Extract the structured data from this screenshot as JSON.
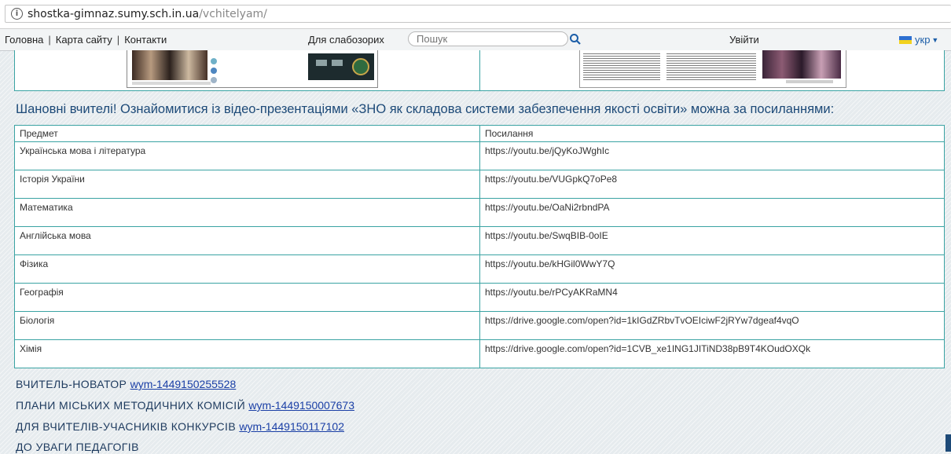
{
  "browser": {
    "url_host": "shostka-gimnaz.sumy.sch.in.ua",
    "url_path": "/vchitelyam/"
  },
  "nav": {
    "home": "Головна",
    "sitemap": "Карта сайту",
    "contacts": "Контакти",
    "visually_impaired": "Для слабозорих",
    "search_placeholder": "Пошук",
    "login": "Увійти",
    "language": "укр"
  },
  "headline": "Шановні вчителі! Ознайомитися із відео-презентаціями «ЗНО як складова системи забезпечення якості освіти» можна за посиланнями:",
  "table": {
    "headers": [
      "Предмет",
      "Посилання"
    ],
    "rows": [
      {
        "subject": "Українська мова і література",
        "link": "https://youtu.be/jQyKoJWghIc"
      },
      {
        "subject": "Історія України",
        "link": "https://youtu.be/VUGpkQ7oPe8"
      },
      {
        "subject": "Математика",
        "link": "https://youtu.be/OaNi2rbndPA"
      },
      {
        "subject": "Англійська мова",
        "link": "https://youtu.be/SwqBIB-0oIE"
      },
      {
        "subject": "Фізика",
        "link": "https://youtu.be/kHGil0WwY7Q"
      },
      {
        "subject": "Географія",
        "link": "https://youtu.be/rPCyAKRaMN4"
      },
      {
        "subject": "Біологія",
        "link": "https://drive.google.com/open?id=1kIGdZRbvTvOEIciwF2jRYw7dgeaf4vqO"
      },
      {
        "subject": "Хімія",
        "link": "https://drive.google.com/open?id=1CVB_xe1ING1JITiND38pB9T4KOudOXQk"
      }
    ]
  },
  "sections": [
    {
      "title": "ВЧИТЕЛЬ-НОВАТОР",
      "link": "wym-1449150255528"
    },
    {
      "title": "ПЛАНИ МІСЬКИХ МЕТОДИЧНИХ КОМІСІЙ",
      "link": "wym-1449150007673"
    },
    {
      "title": "ДЛЯ ВЧИТЕЛІВ-УЧАСНИКІВ КОНКУРСІВ",
      "link": "wym-1449150117102"
    },
    {
      "title": "ДО УВАГИ ПЕДАГОГІВ",
      "link": ""
    }
  ],
  "colors": {
    "table_border": "#3aa3a3",
    "headline": "#1d4a78",
    "link": "#1a3fa6"
  }
}
